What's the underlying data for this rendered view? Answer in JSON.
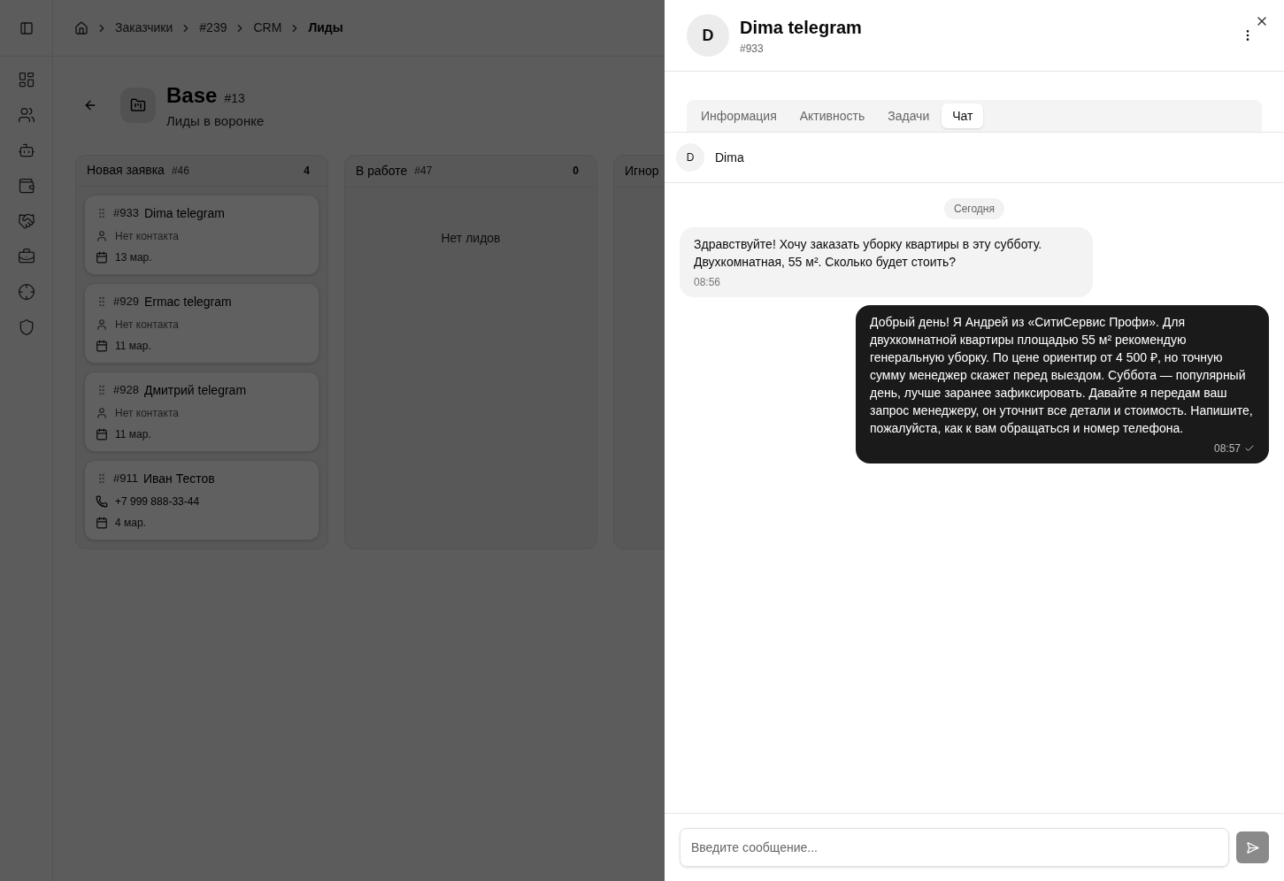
{
  "breadcrumbs": [
    {
      "label": "Заказчики",
      "current": false
    },
    {
      "label": "#239",
      "current": false
    },
    {
      "label": "CRM",
      "current": false
    },
    {
      "label": "Лиды",
      "current": true
    }
  ],
  "page": {
    "title": "Base",
    "id": "#13",
    "subtitle": "Лиды в воронке"
  },
  "columns": [
    {
      "title": "Новая заявка",
      "id": "#46",
      "count": "4",
      "leads": [
        {
          "id": "#933",
          "name": "Dima telegram",
          "kind": "none",
          "contact": "Нет контакта",
          "date": "13 мар."
        },
        {
          "id": "#929",
          "name": "Ermac telegram",
          "kind": "none",
          "contact": "Нет контакта",
          "date": "11 мар."
        },
        {
          "id": "#928",
          "name": "Дмитрий telegram",
          "kind": "none",
          "contact": "Нет контакта",
          "date": "11 мар."
        },
        {
          "id": "#911",
          "name": "Иван Тестов",
          "kind": "phone",
          "contact": "+7 999 888-33-44",
          "date": "4 мар."
        }
      ]
    },
    {
      "title": "В работе",
      "id": "#47",
      "count": "0",
      "empty_text": "Нет лидов"
    },
    {
      "title": "Игнор"
    }
  ],
  "drawer": {
    "avatar": "D",
    "title": "Dima telegram",
    "id": "#933",
    "tabs": [
      {
        "label": "Информация",
        "selected": false
      },
      {
        "label": "Активность",
        "selected": false
      },
      {
        "label": "Задачи",
        "selected": false
      },
      {
        "label": "Чат",
        "selected": true
      }
    ],
    "contact": {
      "avatar": "D",
      "name": "Dima"
    },
    "date_divider": "Сегодня",
    "messages": [
      {
        "kind": "incoming",
        "text": "Здравствуйте! Хочу заказать уборку квартиры в эту субботу. Двухкомнатная, 55 м². Сколько будет стоить?",
        "time": "08:56",
        "delivered": false
      },
      {
        "kind": "outgoing",
        "text": "Добрый день! Я Андрей из «СитиСервис Профи». Для двухкомнатной квартиры площадью 55 м² рекомендую генеральную уборку. По цене ориентир от 4 500 ₽, но точную сумму менеджер скажет перед выездом. Суббота — популярный день, лучше заранее зафиксировать. Давайте я передам ваш запрос менеджеру, он уточнит все детали и стоимость. Напишите, пожалуйста, как к вам обращаться и номер телефона.",
        "time": "08:57",
        "delivered": true
      }
    ],
    "input": {
      "placeholder": "Введите сообщение..."
    }
  }
}
